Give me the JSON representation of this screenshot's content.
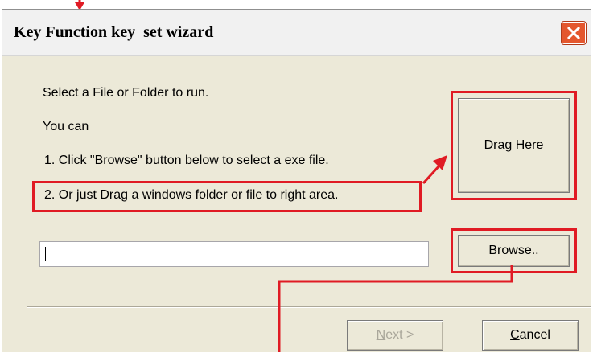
{
  "dialog": {
    "title": "Key Function key  set wizard",
    "close_icon": "close-x-icon"
  },
  "instructions": {
    "line1": "Select a File or Folder to run.",
    "line2": "You can",
    "line3": "1. Click \"Browse\" button below to select a exe file.",
    "line4": "2. Or just Drag a windows folder or file to right area."
  },
  "drop_area": {
    "label": "Drag Here"
  },
  "path_input": {
    "value": "",
    "placeholder": ""
  },
  "buttons": {
    "browse": "Browse..",
    "next_mnemonic": "N",
    "next_rest": "ext >",
    "cancel_mnemonic": "C",
    "cancel_rest": "ancel"
  },
  "annotations": {
    "highlight_color": "#e01b24"
  }
}
